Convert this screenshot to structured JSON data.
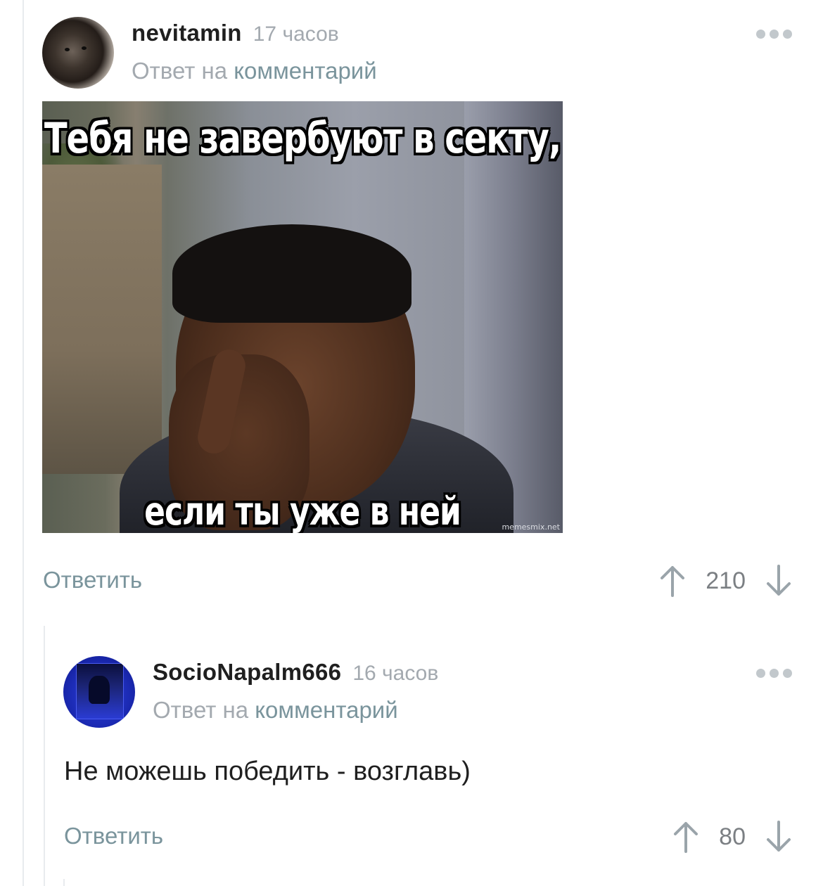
{
  "comments": [
    {
      "username": "nevitamin",
      "time": "17 часов",
      "reply_prefix": "Ответ на",
      "reply_link": "комментарий",
      "image": {
        "top_text": "Тебя не завербуют в секту,",
        "bottom_text": "если ты уже в ней",
        "watermark": "memesmix.net"
      },
      "reply_label": "Ответить",
      "score": "210"
    },
    {
      "username": "SocioNapalm666",
      "time": "16 часов",
      "reply_prefix": "Ответ на",
      "reply_link": "комментарий",
      "text": "Не можешь победить - возглавь)",
      "reply_label": "Ответить",
      "score": "80"
    }
  ]
}
